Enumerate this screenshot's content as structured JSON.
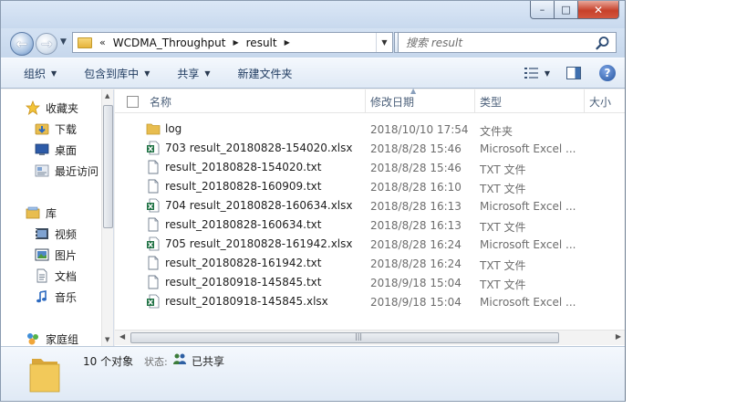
{
  "window": {
    "caption": {
      "minimize": "–",
      "maximize": "□",
      "close": "✕"
    }
  },
  "navigation": {
    "back_glyph": "←",
    "forward_glyph": "→",
    "address": {
      "overflow": "«",
      "crumbs": [
        "WCDMA_Throughput",
        "result"
      ]
    },
    "refresh_glyph": "↻",
    "search": {
      "placeholder": "搜索 result"
    }
  },
  "toolbar": {
    "organize": "组织",
    "include_in_library": "包含到库中",
    "share_with": "共享",
    "new_folder": "新建文件夹"
  },
  "sidebar": {
    "favorites": {
      "label": "收藏夹",
      "items": [
        "下载",
        "桌面",
        "最近访问"
      ]
    },
    "libraries": {
      "label": "库",
      "items": [
        "视频",
        "图片",
        "文档",
        "音乐"
      ]
    },
    "homegroup": {
      "label": "家庭组"
    }
  },
  "columns": {
    "name": "名称",
    "date_modified": "修改日期",
    "type": "类型",
    "size": "大小"
  },
  "files": [
    {
      "name": "log",
      "date": "2018/10/10 17:54",
      "type": "文件夹",
      "icon": "folder-icon"
    },
    {
      "name": "703 result_20180828-154020.xlsx",
      "date": "2018/8/28 15:46",
      "type": "Microsoft Excel ...",
      "icon": "excel-icon"
    },
    {
      "name": "result_20180828-154020.txt",
      "date": "2018/8/28 15:46",
      "type": "TXT 文件",
      "icon": "text-file-icon"
    },
    {
      "name": "result_20180828-160909.txt",
      "date": "2018/8/28 16:10",
      "type": "TXT 文件",
      "icon": "text-file-icon"
    },
    {
      "name": "704 result_20180828-160634.xlsx",
      "date": "2018/8/28 16:13",
      "type": "Microsoft Excel ...",
      "icon": "excel-icon"
    },
    {
      "name": "result_20180828-160634.txt",
      "date": "2018/8/28 16:13",
      "type": "TXT 文件",
      "icon": "text-file-icon"
    },
    {
      "name": "705 result_20180828-161942.xlsx",
      "date": "2018/8/28 16:24",
      "type": "Microsoft Excel ...",
      "icon": "excel-icon"
    },
    {
      "name": "result_20180828-161942.txt",
      "date": "2018/8/28 16:24",
      "type": "TXT 文件",
      "icon": "text-file-icon"
    },
    {
      "name": "result_20180918-145845.txt",
      "date": "2018/9/18 15:04",
      "type": "TXT 文件",
      "icon": "text-file-icon"
    },
    {
      "name": "result_20180918-145845.xlsx",
      "date": "2018/9/18 15:04",
      "type": "Microsoft Excel ...",
      "icon": "excel-icon"
    }
  ],
  "details": {
    "count": "10 个对象",
    "state_label": "状态:",
    "state": "已共享"
  },
  "colors": {
    "accent": "#1e3a5f",
    "folder": "#e6b43c",
    "excel": "#1f7244",
    "close": "#c7402a"
  }
}
